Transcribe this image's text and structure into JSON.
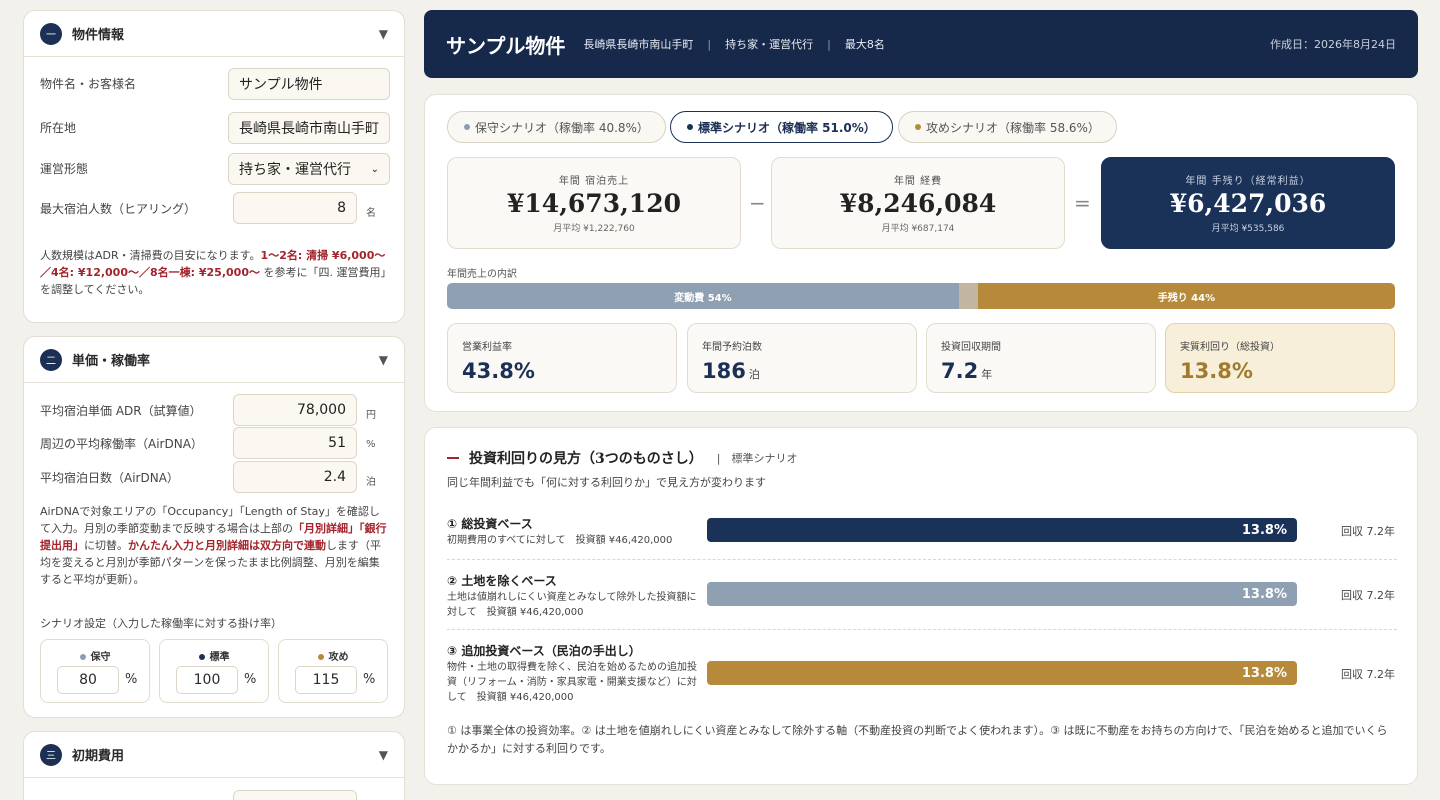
{
  "left": {
    "property": {
      "num": "一",
      "title": "物件情報",
      "fields": [
        {
          "label": "物件名・お客様名",
          "value": "サンプル物件"
        },
        {
          "label": "所在地",
          "value": "長崎県長崎市南山手町"
        },
        {
          "label": "運営形態",
          "value": "持ち家・運営代行"
        },
        {
          "label": "最大宿泊人数（ヒアリング）",
          "value": "8",
          "unit": "名"
        }
      ],
      "note": {
        "pre": "人数規模はADR・清掃費の目安になります。",
        "red": "1〜2名: 清掃 ¥6,000〜／4名: ¥12,000〜／8名一棟: ¥25,000〜",
        "post": " を参考に「四. 運営費用」を調整してください。"
      }
    },
    "rates": {
      "num": "二",
      "title": "単価・稼働率",
      "fields": [
        {
          "label": "平均宿泊単価 ADR（試算値）",
          "value": "78,000",
          "unit": "円"
        },
        {
          "label": "周辺の平均稼働率（AirDNA）",
          "value": "51",
          "unit": "%"
        },
        {
          "label": "平均宿泊日数（AirDNA）",
          "value": "2.4",
          "unit": "泊"
        }
      ],
      "note": {
        "a": "AirDNAで対象エリアの「Occupancy」「Length of Stay」を確認して入力。月別の季節変動まで反映する場合は上部の",
        "b": "「月別詳細」「銀行提出用」",
        "c": "に切替。",
        "d": "かんたん入力と月別詳細は双方向で連動",
        "e": "します（平均を変えると月別が季節パターンを保ったまま比例調整、月別を編集すると平均が更新）。"
      },
      "scenario_label": "シナリオ設定（入力した稼働率に対する掛け率）",
      "scenarios": [
        {
          "name": "保守",
          "value": "80",
          "color": "#8d9db1"
        },
        {
          "name": "標準",
          "value": "100",
          "color": "#1c2f55"
        },
        {
          "name": "攻め",
          "value": "115",
          "color": "#b68a3a"
        }
      ],
      "pct": "%"
    },
    "initial": {
      "num": "三",
      "title": "初期費用"
    }
  },
  "header": {
    "title": "サンプル物件",
    "location": "長崎県長崎市南山手町",
    "type": "持ち家・運営代行",
    "capacity": "最大8名",
    "sep": "|",
    "date": "作成日：2026年8月24日"
  },
  "summary": {
    "pills": [
      {
        "label": "保守シナリオ（稼働率 40.8%）",
        "color": "#8d9db1"
      },
      {
        "label": "標準シナリオ（稼働率 51.0%）",
        "color": "#1c2f55"
      },
      {
        "label": "攻めシナリオ（稼働率 58.6%）",
        "color": "#b68a3a"
      }
    ],
    "revenue": {
      "cap": "年間 宿泊売上",
      "value": "¥14,673,120",
      "sub": "月平均 ¥1,222,760"
    },
    "expense": {
      "cap": "年間 経費",
      "value": "¥8,246,084",
      "sub": "月平均 ¥687,174"
    },
    "profit": {
      "cap": "年間 手残り（経常利益）",
      "value": "¥6,427,036",
      "sub": "月平均 ¥535,586"
    },
    "ops": {
      "minus": "−",
      "equals": "="
    },
    "breakdown_label": "年間売上の内訳",
    "breakdown": [
      {
        "label": "変動費 54%",
        "pct": 54,
        "color": "#8fa0b3"
      },
      {
        "label": "",
        "pct": 2,
        "color": "#c2b6a2"
      },
      {
        "label": "手残り 44%",
        "pct": 44,
        "color": "#b68a3a"
      }
    ],
    "kpis": [
      {
        "cap": "営業利益率",
        "value": "43.8%",
        "unit": ""
      },
      {
        "cap": "年間予約泊数",
        "value": "186",
        "unit": "泊"
      },
      {
        "cap": "投資回収期間",
        "value": "7.2",
        "unit": "年"
      },
      {
        "cap": "実質利回り（総投資）",
        "value": "13.8%",
        "unit": ""
      }
    ]
  },
  "yield": {
    "title": "投資利回りの見方（3つのものさし）",
    "scenario": "|　標準シナリオ",
    "subtitle": "同じ年間利益でも「何に対する利回りか」で見え方が変わります",
    "rows": [
      {
        "title": "① 総投資ベース",
        "desc": "初期費用のすべてに対して　投資額 ¥46,420,000",
        "value": "13.8%",
        "pct": 100,
        "color": "#1b3258",
        "payback": "回収 7.2年"
      },
      {
        "title": "② 土地を除くベース",
        "desc": "土地は値崩れしにくい資産とみなして除外した投資額に対して　投資額 ¥46,420,000",
        "value": "13.8%",
        "pct": 100,
        "color": "#8fa0b3",
        "payback": "回収 7.2年"
      },
      {
        "title": "③ 追加投資ベース（民泊の手出し）",
        "desc": "物件・土地の取得費を除く、民泊を始めるための追加投資（リフォーム・消防・家具家電・開業支援など）に対して　投資額 ¥46,420,000",
        "value": "13.8%",
        "pct": 100,
        "color": "#b68a3a",
        "payback": "回収 7.2年"
      }
    ],
    "footnote": "① は事業全体の投資効率。② は土地を値崩れしにくい資産とみなして除外する軸（不動産投資の判断でよく使われます）。③ は既に不動産をお持ちの方向けで、「民泊を始めると追加でいくらかかるか」に対する利回りです。"
  }
}
